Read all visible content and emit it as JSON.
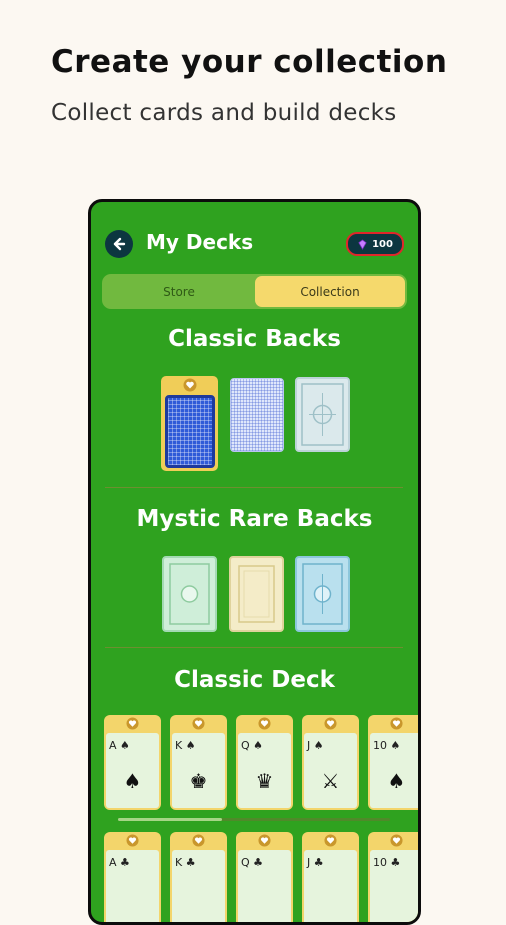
{
  "promo": {
    "headline": "Create your collection",
    "subline": "Collect cards and build decks"
  },
  "app": {
    "title": "My Decks",
    "gems": "100",
    "tabs": [
      {
        "label": "Store",
        "selected": false
      },
      {
        "label": "Collection",
        "selected": true
      }
    ]
  },
  "sections": {
    "classic_backs": "Classic Backs",
    "mystic_backs": "Mystic Rare Backs",
    "classic_deck": "Classic Deck"
  },
  "deck_row1": [
    {
      "rank": "A ♠",
      "figure": "♠"
    },
    {
      "rank": "K ♠",
      "figure": "♚"
    },
    {
      "rank": "Q ♠",
      "figure": "♛"
    },
    {
      "rank": "J ♠",
      "figure": "⚔"
    },
    {
      "rank": "10 ♠",
      "figure": "♠"
    }
  ],
  "deck_row2": [
    {
      "rank": "A ♣"
    },
    {
      "rank": "K ♣"
    },
    {
      "rank": "Q ♣"
    },
    {
      "rank": "J ♣"
    },
    {
      "rank": "10 ♣"
    }
  ],
  "colors": {
    "felt": "#2fa21f",
    "tab_selected": "#f5d96c",
    "navy": "#0c3640",
    "gem_border": "#e0262a"
  },
  "icons": [
    "back-arrow-icon",
    "gem-icon",
    "heart-icon"
  ]
}
